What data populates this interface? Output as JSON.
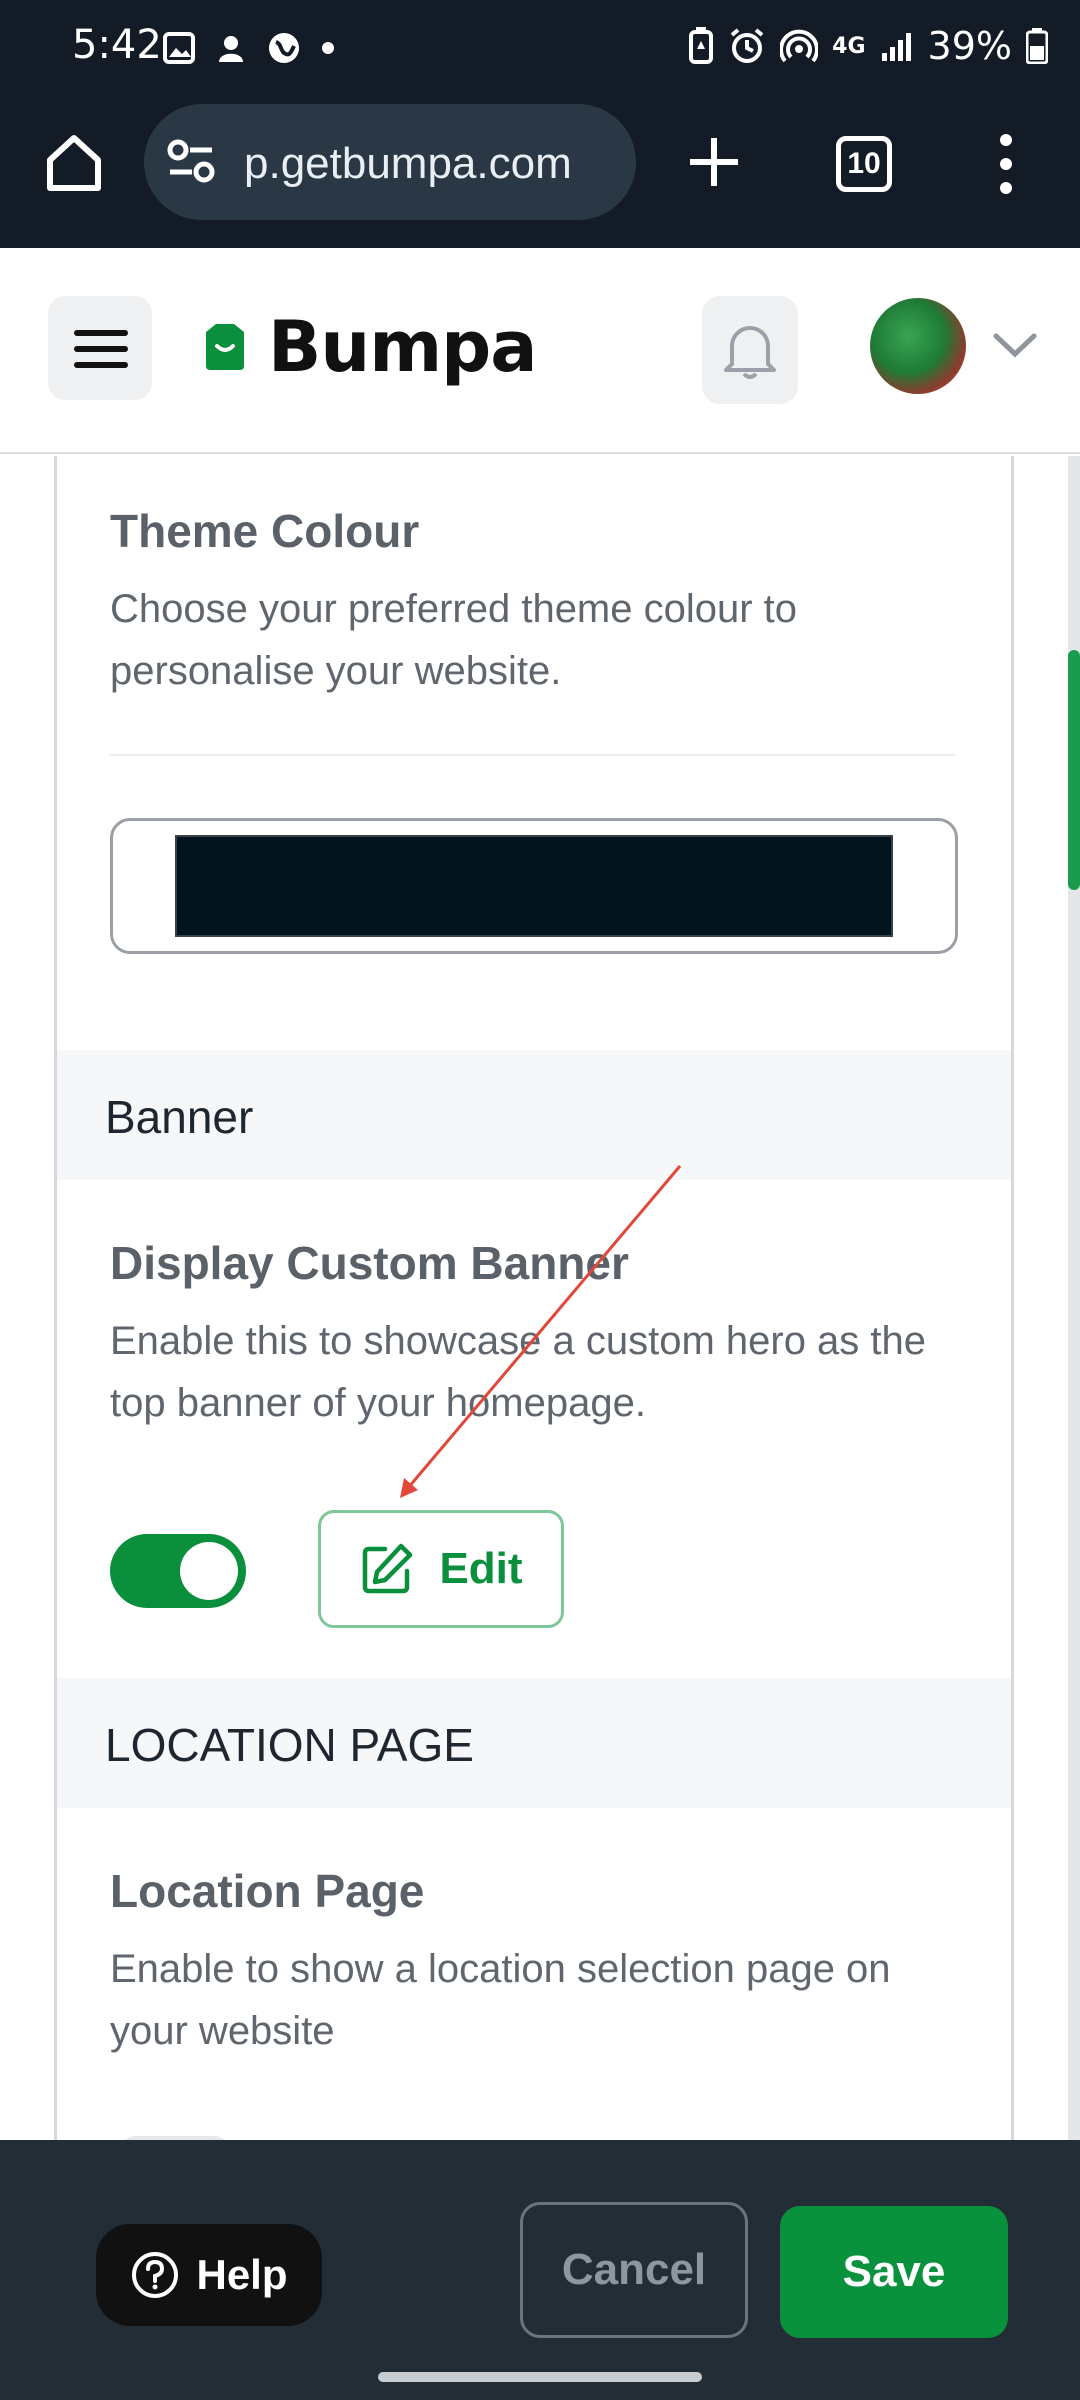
{
  "status_bar": {
    "time": "5:42",
    "network": "4G",
    "battery": "39%",
    "left_icons": [
      "gallery-icon",
      "app-icon",
      "globe-icon",
      "dot-icon"
    ],
    "right_icons": [
      "battery-saver-icon",
      "alarm-icon",
      "hotspot-icon",
      "signal-icon",
      "battery-icon"
    ]
  },
  "browser": {
    "url": "p.getbumpa.com",
    "tab_count": "10"
  },
  "header": {
    "brand": "Bumpa",
    "brand_color": "#0a8f3c"
  },
  "theme_colour": {
    "title": "Theme Colour",
    "description": "Choose your preferred theme colour to personalise your website.",
    "selected_color": "#02141d"
  },
  "banner": {
    "section_title": "Banner",
    "title": "Display Custom Banner",
    "description": "Enable this to showcase a custom hero as the top banner of your homepage.",
    "toggle_on": true,
    "edit_label": "Edit"
  },
  "location": {
    "section_title": "LOCATION PAGE",
    "title": "Location Page",
    "description": "Enable to show a location selection page on your website"
  },
  "footer": {
    "help_label": "Help",
    "cancel_label": "Cancel",
    "save_label": "Save"
  }
}
